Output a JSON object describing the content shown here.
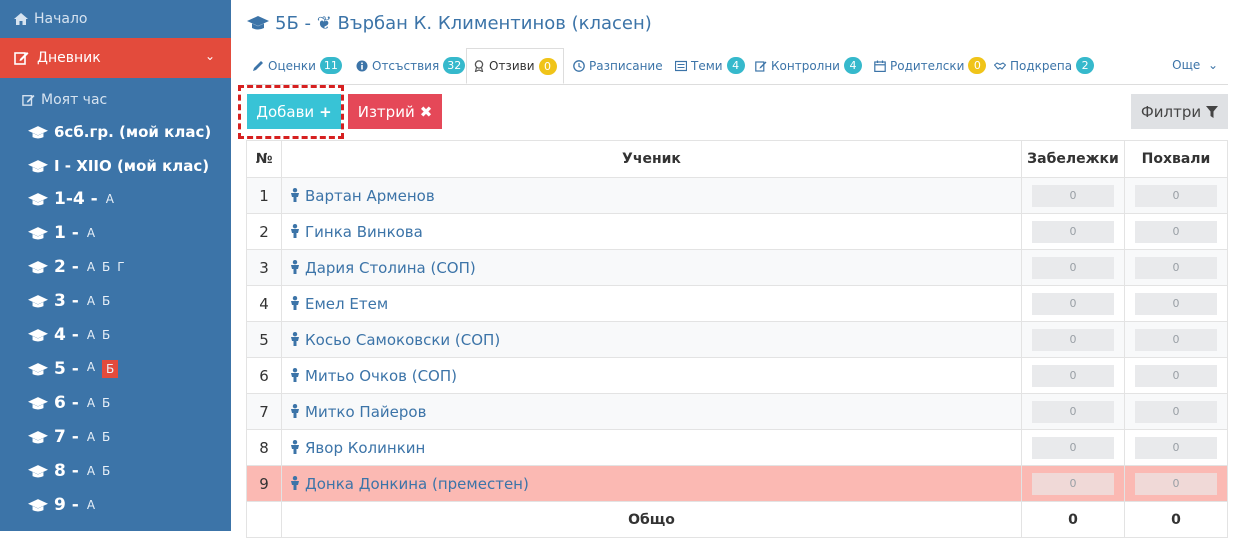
{
  "sidebar": {
    "home_label": "Начало",
    "diary_label": "Дневник",
    "my_hour_label": "Моят час",
    "groups": [
      {
        "label": "6сб.гр. (мой клас)"
      },
      {
        "label": "I - XIIO (мой клас)"
      }
    ],
    "grades": [
      {
        "label": "1-4 -",
        "letters": [
          "А"
        ],
        "active": ""
      },
      {
        "label": "1 -",
        "letters": [
          "А"
        ],
        "active": ""
      },
      {
        "label": "2 -",
        "letters": [
          "А",
          "Б",
          "Г"
        ],
        "active": ""
      },
      {
        "label": "3 -",
        "letters": [
          "А",
          "Б"
        ],
        "active": ""
      },
      {
        "label": "4 -",
        "letters": [
          "А",
          "Б"
        ],
        "active": ""
      },
      {
        "label": "5 -",
        "letters": [
          "А",
          "Б"
        ],
        "active": "Б"
      },
      {
        "label": "6 -",
        "letters": [
          "А",
          "Б"
        ],
        "active": ""
      },
      {
        "label": "7 -",
        "letters": [
          "А",
          "Б"
        ],
        "active": ""
      },
      {
        "label": "8 -",
        "letters": [
          "А",
          "Б"
        ],
        "active": ""
      },
      {
        "label": "9 -",
        "letters": [
          "А"
        ],
        "active": ""
      }
    ],
    "colors": {
      "bg": "#3c74a8",
      "active": "#e34b3c"
    }
  },
  "header": {
    "title": "5Б - ❦ Върбан К. Климентинов (класен)"
  },
  "tabs": [
    {
      "label": "Оценки",
      "icon": "pencil-icon",
      "badge": "11",
      "badge_color": "teal"
    },
    {
      "label": "Отсъствия",
      "icon": "info-icon",
      "badge": "32",
      "badge_color": "teal"
    },
    {
      "label": "Отзиви",
      "icon": "award-icon",
      "badge": "0",
      "badge_color": "yellow",
      "active": true
    },
    {
      "label": "Разписание",
      "icon": "clock-icon",
      "badge": "",
      "badge_color": ""
    },
    {
      "label": "Теми",
      "icon": "list-icon",
      "badge": "4",
      "badge_color": "teal"
    },
    {
      "label": "Контролни",
      "icon": "edit-icon",
      "badge": "4",
      "badge_color": "teal"
    },
    {
      "label": "Родителски",
      "icon": "calendar-icon",
      "badge": "0",
      "badge_color": "yellow"
    },
    {
      "label": "Подкрепа",
      "icon": "handshake-icon",
      "badge": "2",
      "badge_color": "teal"
    }
  ],
  "more_label": "Още",
  "toolbar": {
    "add_label": "Добави",
    "delete_label": "Изтрий",
    "filter_label": "Филтри"
  },
  "table": {
    "headers": {
      "num": "№",
      "student": "Ученик",
      "notes": "Забележки",
      "praise": "Похвали"
    },
    "rows": [
      {
        "num": "1",
        "name": "Вартан Арменов",
        "notes": "0",
        "praise": "0"
      },
      {
        "num": "2",
        "name": "Гинка Винкова",
        "notes": "0",
        "praise": "0"
      },
      {
        "num": "3",
        "name": "Дария Столина (СОП)",
        "notes": "0",
        "praise": "0"
      },
      {
        "num": "4",
        "name": "Емел Етем",
        "notes": "0",
        "praise": "0"
      },
      {
        "num": "5",
        "name": "Косьо Самоковски (СОП)",
        "notes": "0",
        "praise": "0"
      },
      {
        "num": "6",
        "name": "Митьо Очков (СОП)",
        "notes": "0",
        "praise": "0"
      },
      {
        "num": "7",
        "name": "Митко Пайеров",
        "notes": "0",
        "praise": "0"
      },
      {
        "num": "8",
        "name": "Явор Колинкин",
        "notes": "0",
        "praise": "0"
      },
      {
        "num": "9",
        "name": "Донка Донкина (преместен)",
        "notes": "0",
        "praise": "0",
        "moved": true
      }
    ],
    "total": {
      "label": "Общо",
      "notes": "0",
      "praise": "0"
    }
  }
}
